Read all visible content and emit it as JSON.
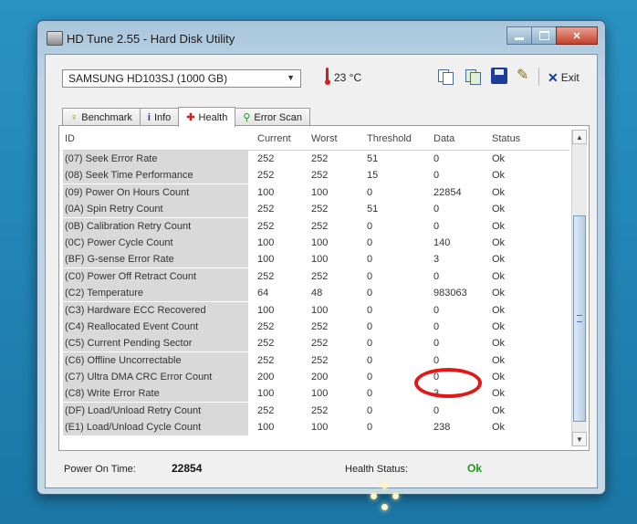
{
  "window": {
    "title": "HD Tune 2.55 - Hard Disk Utility"
  },
  "toolbar": {
    "drive": "SAMSUNG HD103SJ (1000 GB)",
    "temperature": "23 °C",
    "exit_label": "Exit"
  },
  "tabs": [
    {
      "label": "Benchmark",
      "icon": "benchmark-icon"
    },
    {
      "label": "Info",
      "icon": "info-icon"
    },
    {
      "label": "Health",
      "icon": "health-icon",
      "active": true
    },
    {
      "label": "Error Scan",
      "icon": "magnifier-icon"
    }
  ],
  "table": {
    "headers": {
      "id": "ID",
      "current": "Current",
      "worst": "Worst",
      "threshold": "Threshold",
      "data": "Data",
      "status": "Status"
    },
    "rows": [
      {
        "id": "(07) Seek Error Rate",
        "current": "252",
        "worst": "252",
        "threshold": "51",
        "data": "0",
        "status": "Ok"
      },
      {
        "id": "(08) Seek Time Performance",
        "current": "252",
        "worst": "252",
        "threshold": "15",
        "data": "0",
        "status": "Ok"
      },
      {
        "id": "(09) Power On Hours Count",
        "current": "100",
        "worst": "100",
        "threshold": "0",
        "data": "22854",
        "status": "Ok"
      },
      {
        "id": "(0A) Spin Retry Count",
        "current": "252",
        "worst": "252",
        "threshold": "51",
        "data": "0",
        "status": "Ok"
      },
      {
        "id": "(0B) Calibration Retry Count",
        "current": "252",
        "worst": "252",
        "threshold": "0",
        "data": "0",
        "status": "Ok"
      },
      {
        "id": "(0C) Power Cycle Count",
        "current": "100",
        "worst": "100",
        "threshold": "0",
        "data": "140",
        "status": "Ok"
      },
      {
        "id": "(BF) G-sense Error Rate",
        "current": "100",
        "worst": "100",
        "threshold": "0",
        "data": "3",
        "status": "Ok"
      },
      {
        "id": "(C0) Power Off Retract Count",
        "current": "252",
        "worst": "252",
        "threshold": "0",
        "data": "0",
        "status": "Ok"
      },
      {
        "id": "(C2) Temperature",
        "current": "64",
        "worst": "48",
        "threshold": "0",
        "data": "983063",
        "status": "Ok"
      },
      {
        "id": "(C3) Hardware ECC Recovered",
        "current": "100",
        "worst": "100",
        "threshold": "0",
        "data": "0",
        "status": "Ok"
      },
      {
        "id": "(C4) Reallocated Event Count",
        "current": "252",
        "worst": "252",
        "threshold": "0",
        "data": "0",
        "status": "Ok"
      },
      {
        "id": "(C5) Current Pending Sector",
        "current": "252",
        "worst": "252",
        "threshold": "0",
        "data": "0",
        "status": "Ok"
      },
      {
        "id": "(C6) Offline Uncorrectable",
        "current": "252",
        "worst": "252",
        "threshold": "0",
        "data": "0",
        "status": "Ok"
      },
      {
        "id": "(C7) Ultra DMA CRC Error Count",
        "current": "200",
        "worst": "200",
        "threshold": "0",
        "data": "0",
        "status": "Ok"
      },
      {
        "id": "(C8) Write Error Rate",
        "current": "100",
        "worst": "100",
        "threshold": "0",
        "data": "3",
        "status": "Ok"
      },
      {
        "id": "(DF) Load/Unload Retry Count",
        "current": "252",
        "worst": "252",
        "threshold": "0",
        "data": "0",
        "status": "Ok"
      },
      {
        "id": "(E1) Load/Unload Cycle Count",
        "current": "100",
        "worst": "100",
        "threshold": "0",
        "data": "238",
        "status": "Ok"
      }
    ]
  },
  "status_bar": {
    "power_on_label": "Power On Time:",
    "power_on_value": "22854",
    "health_label": "Health Status:",
    "health_value": "Ok"
  },
  "colors": {
    "ok_green": "#1a9a1a",
    "highlight_red": "#e21818",
    "thermometer": "#d02020"
  }
}
